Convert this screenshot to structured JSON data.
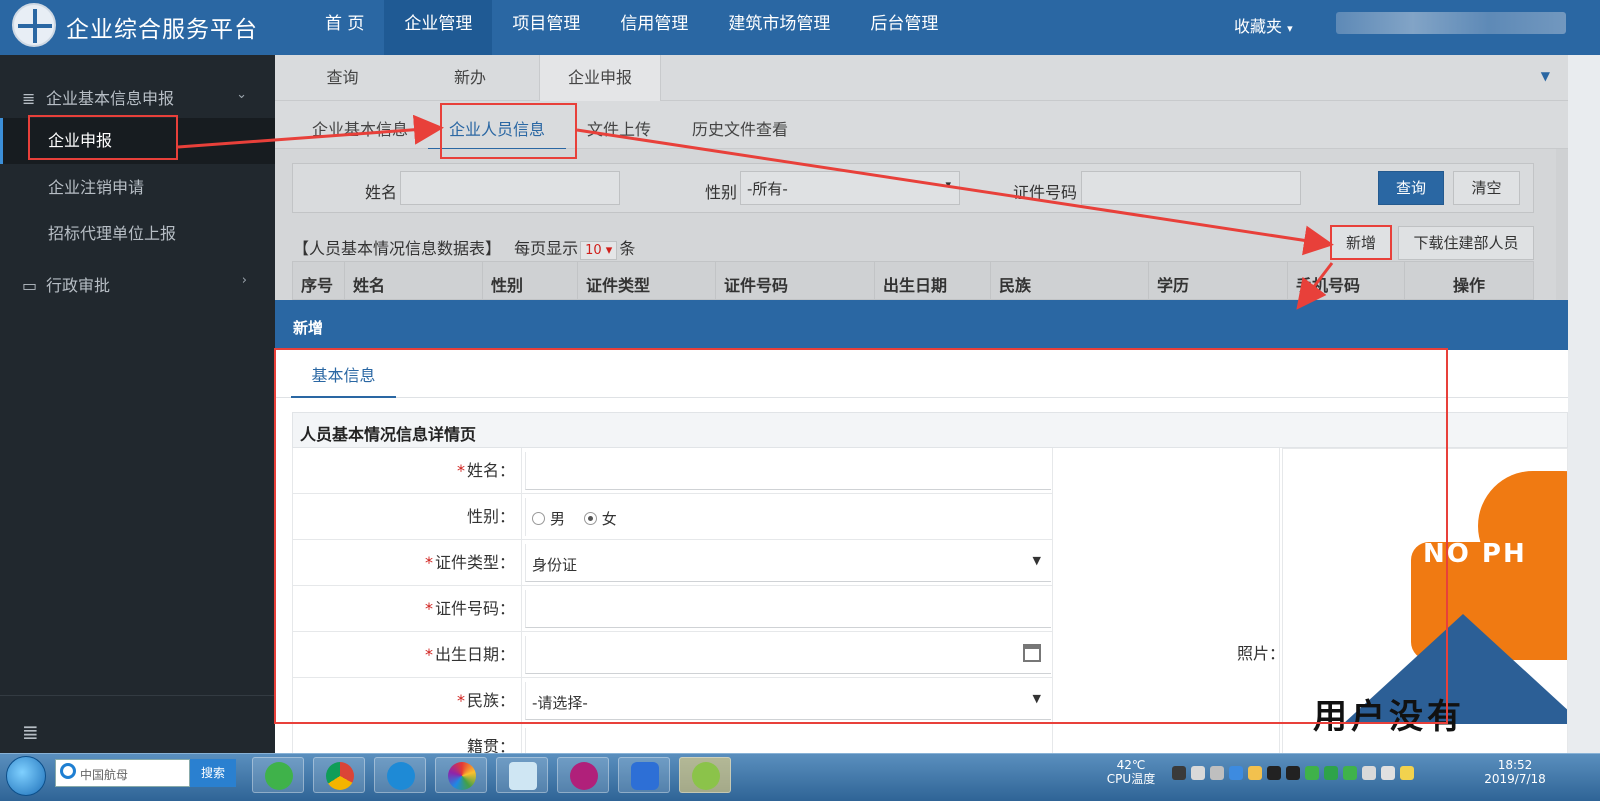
{
  "header": {
    "brand": "企业综合服务平台",
    "nav": [
      "首 页",
      "企业管理",
      "项目管理",
      "信用管理",
      "建筑市场管理",
      "后台管理"
    ],
    "active_nav": "企业管理",
    "favorites": "收藏夹",
    "favorites_caret": "▾"
  },
  "sidebar": {
    "group1": "企业基本信息申报",
    "group1_chevron": "⌄",
    "items": [
      "企业申报",
      "企业注销申请",
      "招标代理单位上报"
    ],
    "group2": "行政审批",
    "group2_chevron": "›",
    "group1_icon": "≣",
    "group2_icon": "▭",
    "bottom_icon": "≣"
  },
  "tabs_top": {
    "items": [
      "查询",
      "新办",
      "企业申报"
    ],
    "caret": "▼"
  },
  "tabs_sub": {
    "items": [
      "企业基本信息",
      "企业人员信息",
      "文件上传",
      "历史文件查看"
    ]
  },
  "search": {
    "name_label": "姓名",
    "gender_label": "性别",
    "gender_value": "-所有-",
    "id_label": "证件号码",
    "query_button": "查询",
    "clear_button": "清空",
    "select_arrow": "▾"
  },
  "table": {
    "title_pre": "【人员基本情况信息数据表】",
    "per_page_label": "每页显示",
    "per_page_value": "10 ▾",
    "per_page_unit": "条",
    "add_button": "新增",
    "download_button": "下载住建部人员",
    "columns": [
      "序号",
      "姓名",
      "性别",
      "证件类型",
      "证件号码",
      "出生日期",
      "民族",
      "学历",
      "手机号码",
      "操作"
    ]
  },
  "modal": {
    "title": "新增",
    "tab": "基本信息",
    "detail_title": "人员基本情况信息详情页",
    "required_mark": "*",
    "fields": [
      {
        "label": "姓名：",
        "required": true,
        "value": ""
      },
      {
        "label": "性别：",
        "required": false,
        "male": "男",
        "female": "女"
      },
      {
        "label": "证件类型：",
        "required": true,
        "value": "身份证",
        "arrow": "▼"
      },
      {
        "label": "证件号码：",
        "required": true,
        "value": ""
      },
      {
        "label": "出生日期：",
        "required": true,
        "value": ""
      },
      {
        "label": "民族：",
        "required": true,
        "value": "-请选择-",
        "arrow": "▼"
      },
      {
        "label": "籍贯：",
        "required": false,
        "value": ""
      }
    ],
    "photo_label": "照片：",
    "photo_text_top": "NO PH",
    "photo_text_bottom": "用户没有"
  },
  "taskbar": {
    "search_placeholder": "中国航母",
    "search_button": "搜索",
    "temp": "42℃",
    "temp_label": "CPU温度",
    "time": "18:52",
    "date": "2019/7/18"
  },
  "colors": {
    "primary": "#2a67a3",
    "sidebar": "#21282e",
    "annotation": "#e8403a"
  }
}
